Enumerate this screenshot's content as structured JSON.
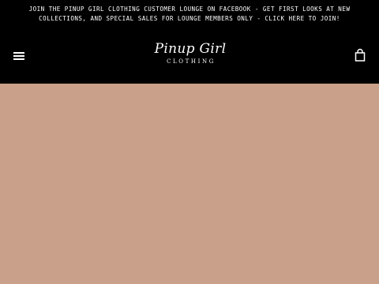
{
  "announcement": {
    "line1": "JOIN THE PINUP GIRL CLOTHING CUSTOMER LOUNGE ON FACEBOOK - GET FIRST LOOKS AT NEW",
    "line2": "COLLECTIONS, AND SPECIAL SALES FOR LOUNGE MEMBERS ONLY - CLICK HERE TO JOIN!"
  },
  "header": {
    "menu_icon": "hamburger-menu-icon",
    "logo_script": "Pinup Girl",
    "logo_sub": "CLOTHING",
    "cart_icon": "shopping-bag-icon"
  },
  "colors": {
    "header_bg": "#000000",
    "header_text": "#ffffff",
    "hero_bg": "#c9a08a"
  }
}
